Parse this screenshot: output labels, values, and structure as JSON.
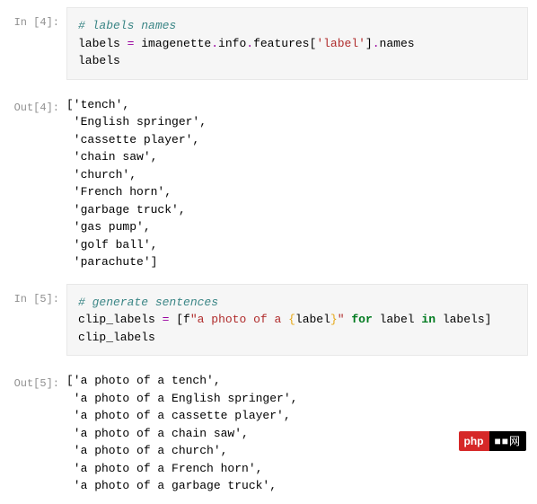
{
  "cells": {
    "in4": {
      "prompt": "In [4]:",
      "comment": "# labels names",
      "assign_lhs": "labels",
      "assign_eq": " = ",
      "rhs_a": "imagenette",
      "rhs_dot1": ".",
      "rhs_b": "info",
      "rhs_dot2": ".",
      "rhs_c": "features",
      "rhs_lbr": "[",
      "rhs_str": "'label'",
      "rhs_rbr": "]",
      "rhs_dot3": ".",
      "rhs_d": "names",
      "echo": "labels"
    },
    "out4": {
      "prompt": "Out[4]:",
      "text": "['tench',\n 'English springer',\n 'cassette player',\n 'chain saw',\n 'church',\n 'French horn',\n 'garbage truck',\n 'gas pump',\n 'golf ball',\n 'parachute']"
    },
    "in5": {
      "prompt": "In [5]:",
      "comment": "# generate sentences",
      "lhs": "clip_labels",
      "eq": " = ",
      "lbr": "[",
      "fprefix": "f",
      "fopen": "\"a photo of a ",
      "brace_open": "{",
      "inner": "label",
      "brace_close": "}",
      "fclose": "\"",
      "sp1": " ",
      "kw_for": "for",
      "sp2": " ",
      "var_label": "label",
      "sp3": " ",
      "kw_in": "in",
      "sp4": " ",
      "var_labels": "labels",
      "rbr": "]",
      "echo": "clip_labels"
    },
    "out5": {
      "prompt": "Out[5]:",
      "text": "['a photo of a tench',\n 'a photo of a English springer',\n 'a photo of a cassette player',\n 'a photo of a chain saw',\n 'a photo of a church',\n 'a photo of a French horn',\n 'a photo of a garbage truck',"
    }
  },
  "watermark": {
    "left": "php",
    "right": "■■网"
  }
}
